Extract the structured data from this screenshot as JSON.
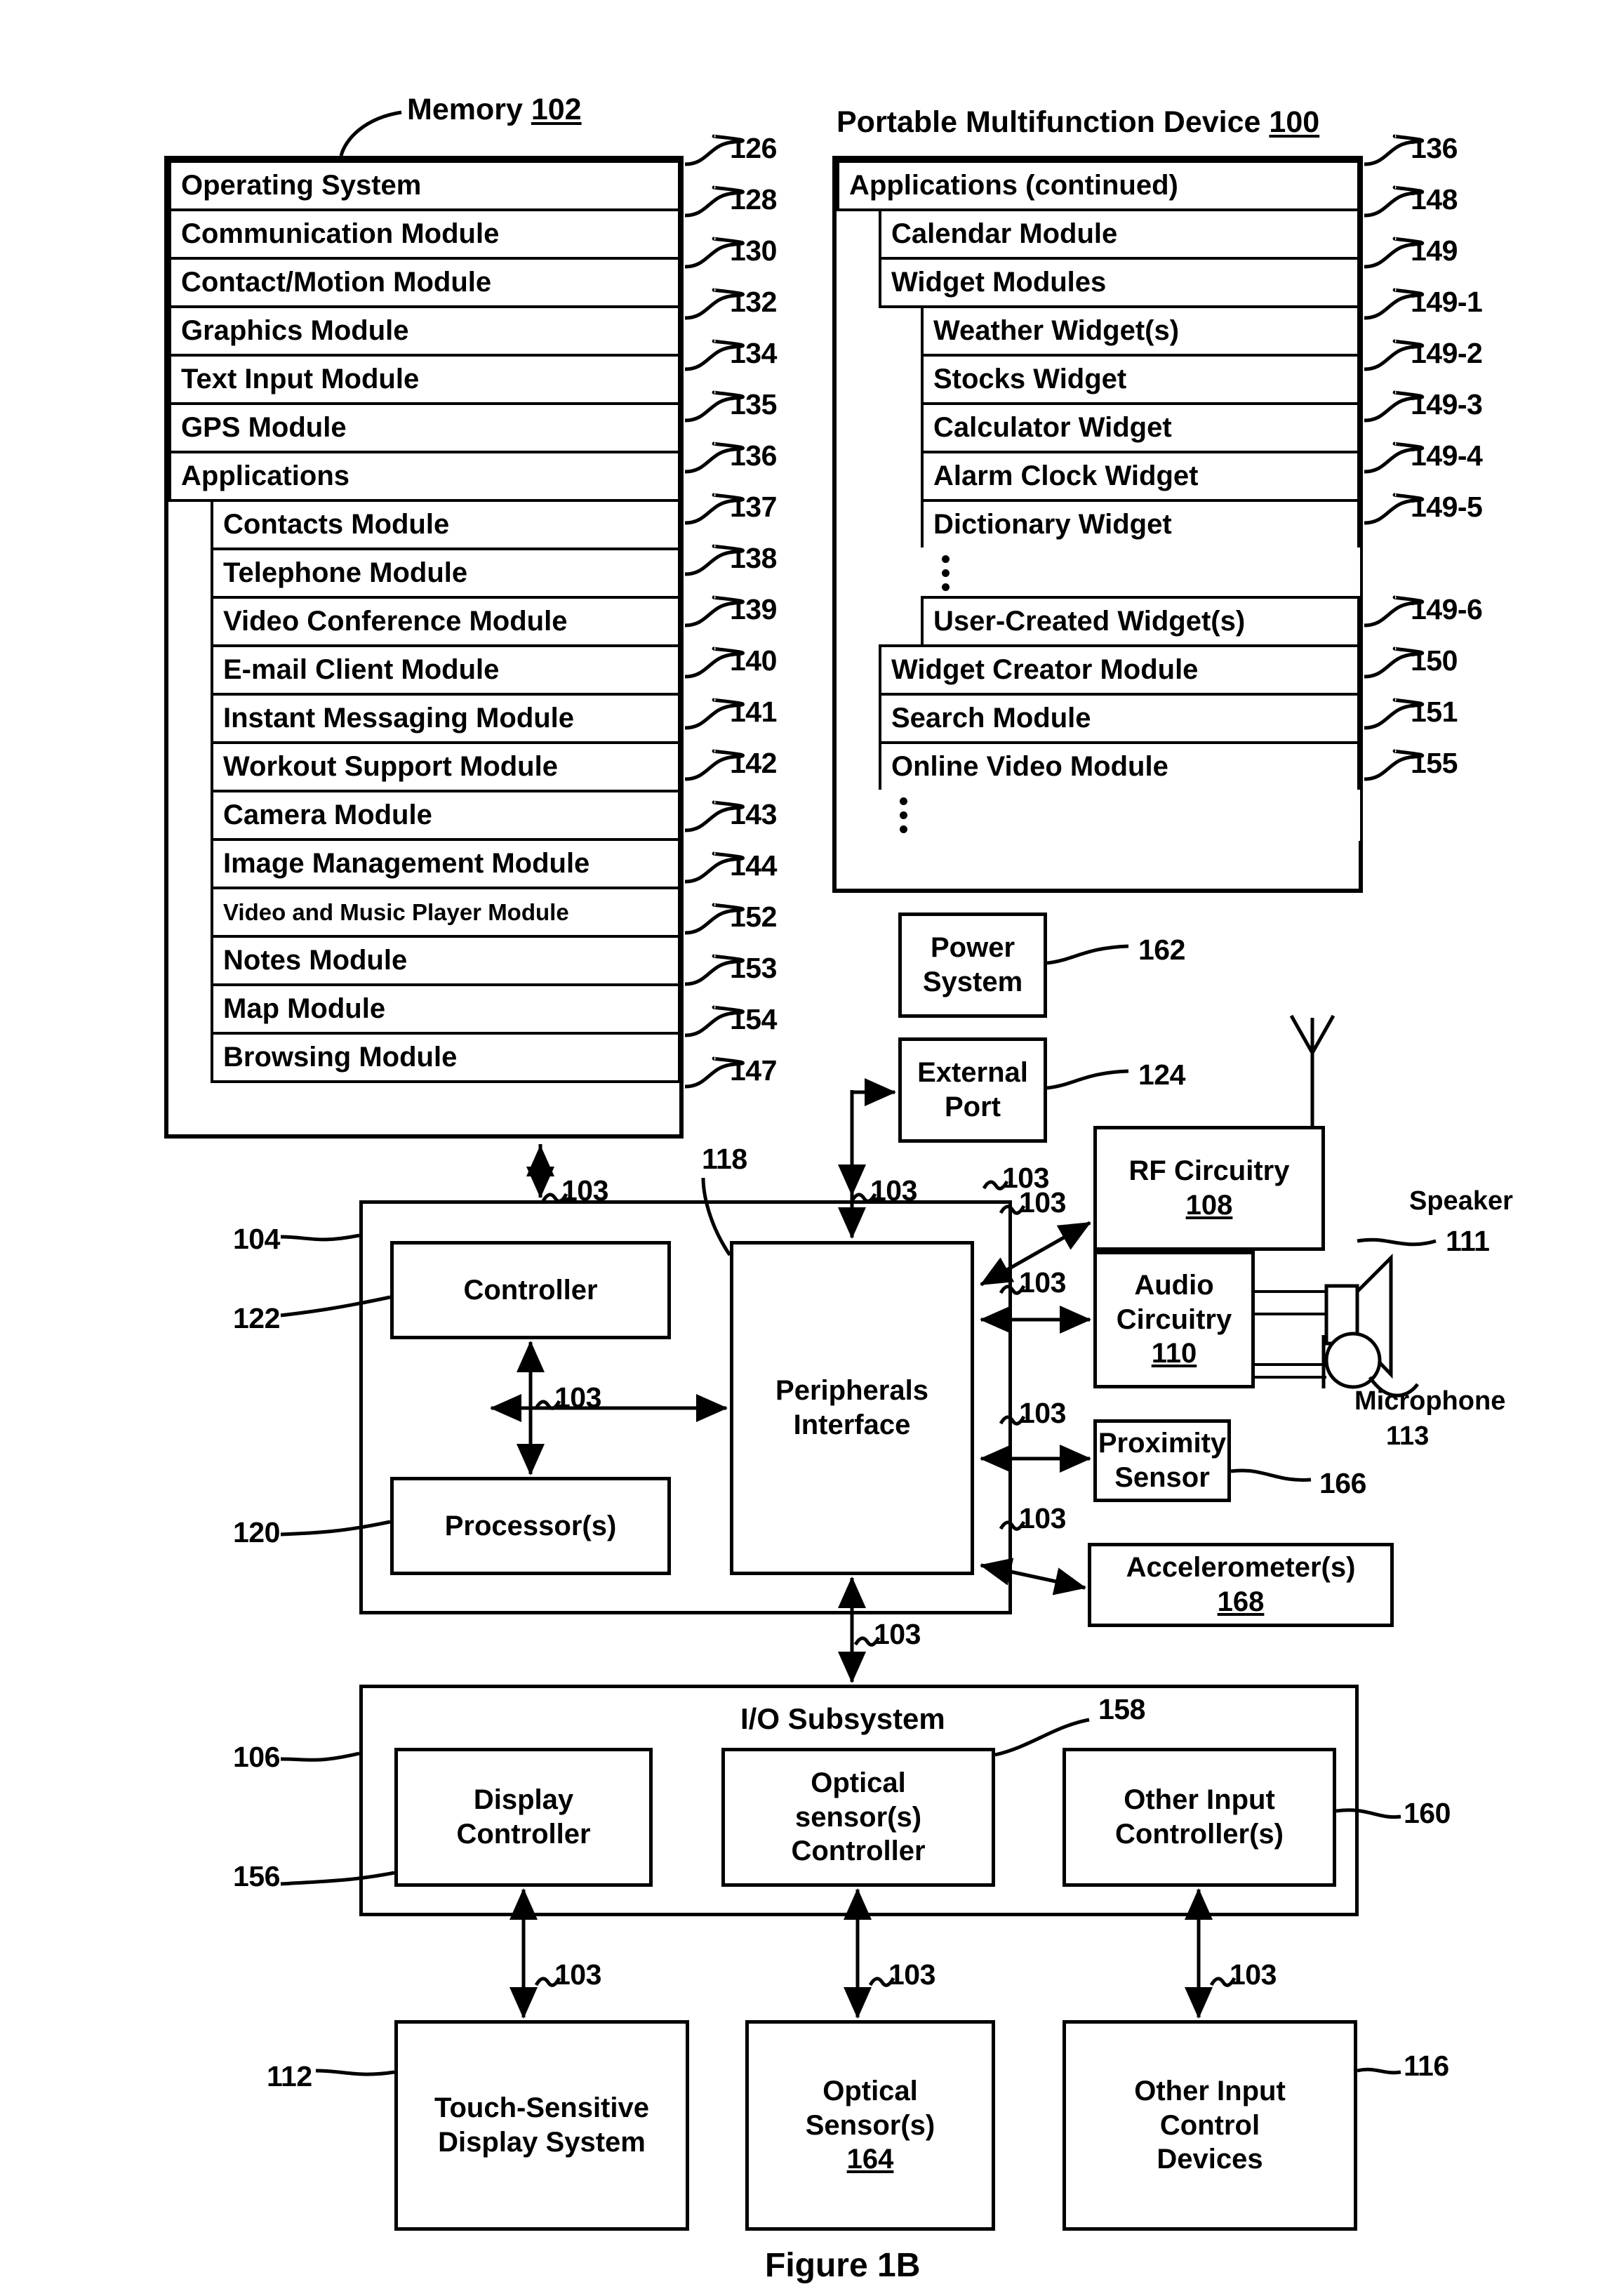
{
  "figure": {
    "caption": "Figure 1B"
  },
  "memory": {
    "title_text": "Memory",
    "title_ref": "102",
    "rows": [
      {
        "label": "Operating System",
        "ref": "126",
        "level": 0
      },
      {
        "label": "Communication Module",
        "ref": "128",
        "level": 0
      },
      {
        "label": "Contact/Motion Module",
        "ref": "130",
        "level": 0
      },
      {
        "label": "Graphics Module",
        "ref": "132",
        "level": 0
      },
      {
        "label": "Text Input Module",
        "ref": "134",
        "level": 0
      },
      {
        "label": "GPS Module",
        "ref": "135",
        "level": 0
      },
      {
        "label": "Applications",
        "ref": "136",
        "level": 0
      },
      {
        "label": "Contacts Module",
        "ref": "137",
        "level": 1
      },
      {
        "label": "Telephone Module",
        "ref": "138",
        "level": 1
      },
      {
        "label": "Video Conference Module",
        "ref": "139",
        "level": 1
      },
      {
        "label": "E-mail Client Module",
        "ref": "140",
        "level": 1
      },
      {
        "label": "Instant Messaging Module",
        "ref": "141",
        "level": 1
      },
      {
        "label": "Workout Support Module",
        "ref": "142",
        "level": 1
      },
      {
        "label": "Camera Module",
        "ref": "143",
        "level": 1
      },
      {
        "label": "Image Management Module",
        "ref": "144",
        "level": 1
      },
      {
        "label": "Video and Music Player Module",
        "ref": "152",
        "level": 1,
        "small": true
      },
      {
        "label": "Notes Module",
        "ref": "153",
        "level": 1
      },
      {
        "label": "Map Module",
        "ref": "154",
        "level": 1
      },
      {
        "label": "Browsing Module",
        "ref": "147",
        "level": 1
      }
    ]
  },
  "device": {
    "title_text": "Portable Multifunction Device",
    "title_ref": "100",
    "rows": [
      {
        "label": "Applications (continued)",
        "ref": "136",
        "level": 0
      },
      {
        "label": "Calendar Module",
        "ref": "148",
        "level": 1
      },
      {
        "label": "Widget Modules",
        "ref": "149",
        "level": 1
      },
      {
        "label": "Weather Widget(s)",
        "ref": "149-1",
        "level": 2
      },
      {
        "label": "Stocks Widget",
        "ref": "149-2",
        "level": 2
      },
      {
        "label": "Calculator Widget",
        "ref": "149-3",
        "level": 2
      },
      {
        "label": "Alarm Clock Widget",
        "ref": "149-4",
        "level": 2
      },
      {
        "label": "Dictionary Widget",
        "ref": "149-5",
        "level": 2
      },
      {
        "label": "",
        "ref": "",
        "level": 2,
        "ellipsis": true
      },
      {
        "label": "User-Created Widget(s)",
        "ref": "149-6",
        "level": 2
      },
      {
        "label": "Widget Creator Module",
        "ref": "150",
        "level": 1
      },
      {
        "label": "Search Module",
        "ref": "151",
        "level": 1
      },
      {
        "label": "Online Video Module",
        "ref": "155",
        "level": 1
      },
      {
        "label": "",
        "ref": "",
        "level": 1,
        "ellipsis": true
      }
    ]
  },
  "blocks": {
    "power_system": {
      "label": "Power\nSystem",
      "ref": "162"
    },
    "external_port": {
      "label": "External\nPort",
      "ref": "124"
    },
    "rf_circuitry": {
      "label": "RF Circuitry",
      "ref": "108"
    },
    "audio_circuitry": {
      "label": "Audio\nCircuitry",
      "ref": "110"
    },
    "proximity": {
      "label": "Proximity\nSensor",
      "ref": "166"
    },
    "accelerometer": {
      "label": "Accelerometer(s)",
      "ref": "168"
    },
    "controller": {
      "label": "Controller",
      "ref": "122"
    },
    "processors": {
      "label": "Processor(s)",
      "ref": "120"
    },
    "peripherals": {
      "label": "Peripherals\nInterface",
      "ref": "118"
    },
    "cpu_group_ref": "104",
    "io_subsystem": {
      "label": "I/O Subsystem",
      "ref": "158",
      "outer_ref": "106"
    },
    "display_ctrl": {
      "label": "Display\nController",
      "ref": "156"
    },
    "optical_ctrl": {
      "label": "Optical\nsensor(s)\nController"
    },
    "other_input_ctrl": {
      "label": "Other Input\nController(s)",
      "ref": "160"
    },
    "touch_display": {
      "label": "Touch-Sensitive\nDisplay System",
      "ref": "112"
    },
    "optical_sensor": {
      "label": "Optical\nSensor(s)",
      "ref": "164"
    },
    "other_input_dev": {
      "label": "Other Input\nControl\nDevices",
      "ref": "116"
    },
    "speaker": {
      "label": "Speaker",
      "ref": "111"
    },
    "microphone": {
      "label": "Microphone",
      "ref": "113"
    }
  },
  "bus_label": "103",
  "bus_labels_count": 12,
  "colors": {
    "ink": "#000000",
    "paper": "#ffffff"
  }
}
